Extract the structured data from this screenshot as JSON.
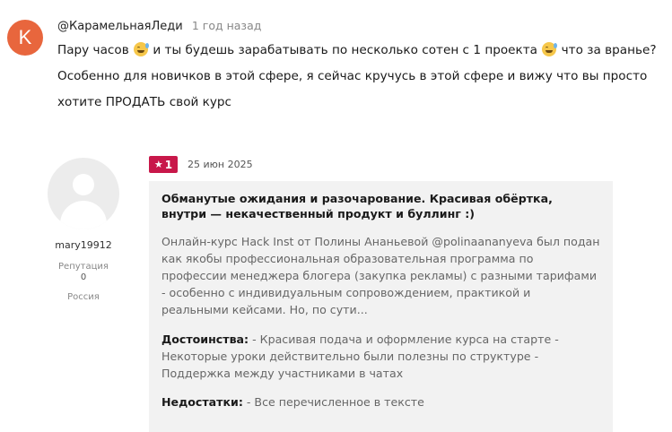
{
  "comment": {
    "avatar_letter": "K",
    "avatar_color": "#e8663d",
    "author": "@КарамельнаяЛеди",
    "time": "1 год назад",
    "text_part1": "Пару часов",
    "text_part2": "и ты будешь зарабатывать по несколько сотен с 1 проекта",
    "text_part3": "что за вранье? Особенно для новичков в этой сфере, я сейчас кручусь в этой сфере и вижу что вы просто хотите ПРОДАТЬ свой курс",
    "emoji_icon": "grinning-sweat-emoji"
  },
  "review": {
    "username": "mary19912",
    "reputation_label": "Репутация",
    "reputation_value": "0",
    "country": "Россия",
    "rating": "1",
    "rating_color": "#c8184a",
    "date": "25 июн 2025",
    "title": "Обманутые ожидания и разочарование. Красивая обёртка, внутри — некачественный продукт и буллинг :)",
    "body": "Онлайн-курс Hack Inst от Полины Ананьевой @polinaananyeva был подан как якобы профессиональная образовательная программа по профессии менеджера блогера (закупка рекламы) с разными тарифами - особенно с индивидуальным сопровождением, практикой и реальными кейсами. Но, по сути...",
    "pros_label": "Достоинства:",
    "pros_text": " - Красивая подача и оформление курса на старте - Некоторые уроки действительно были полезны по структуре - Поддержка между участниками в чатах",
    "cons_label": "Недостатки:",
    "cons_text": " - Все перечисленное в тексте"
  }
}
